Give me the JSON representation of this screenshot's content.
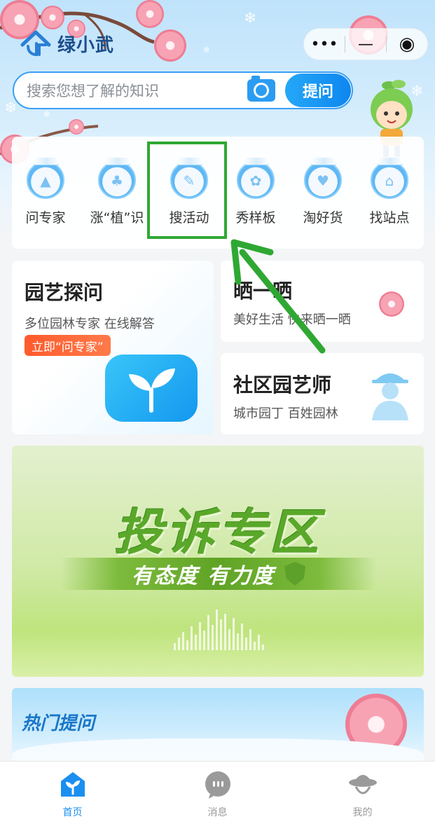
{
  "app": {
    "name": "绿小武"
  },
  "capsule": {
    "more_icon": "•••",
    "minimize_icon": "—",
    "close_icon": "◉"
  },
  "search": {
    "placeholder": "搜索您想了解的知识",
    "ask_label": "提问"
  },
  "quick_nav": [
    {
      "label": "问专家",
      "icon": "graduation-cap-icon",
      "glyph": "▲"
    },
    {
      "label": "涨“植”识",
      "icon": "clover-icon",
      "glyph": "♣"
    },
    {
      "label": "搜活动",
      "icon": "document-edit-icon",
      "glyph": "✎"
    },
    {
      "label": "秀样板",
      "icon": "paw-icon",
      "glyph": "✿"
    },
    {
      "label": "淘好货",
      "icon": "hand-leaf-icon",
      "glyph": "♥"
    },
    {
      "label": "找站点",
      "icon": "location-icon",
      "glyph": "⌂"
    }
  ],
  "cards": {
    "garden_ask": {
      "title": "园艺探问",
      "subtitle": "多位园林专家 在线解答",
      "tag": "立即“问专家”"
    },
    "share": {
      "title": "晒一晒",
      "subtitle": "美好生活 快来晒一晒"
    },
    "community": {
      "title": "社区园艺师",
      "subtitle": "城市园丁 百姓园林"
    }
  },
  "banner": {
    "title": "投诉专区",
    "subtitle": "有态度 有力度"
  },
  "hot": {
    "title": "热门提问"
  },
  "tabs": [
    {
      "label": "首页",
      "icon": "home-leaf-icon",
      "active": true
    },
    {
      "label": "消息",
      "icon": "chat-bubble-icon",
      "active": false
    },
    {
      "label": "我的",
      "icon": "person-hat-icon",
      "active": false
    }
  ],
  "colors": {
    "accent": "#1a8ff0",
    "highlight": "#2fa833",
    "banner_green": "#5aa82a",
    "tag_orange": "#ff5a2c"
  }
}
